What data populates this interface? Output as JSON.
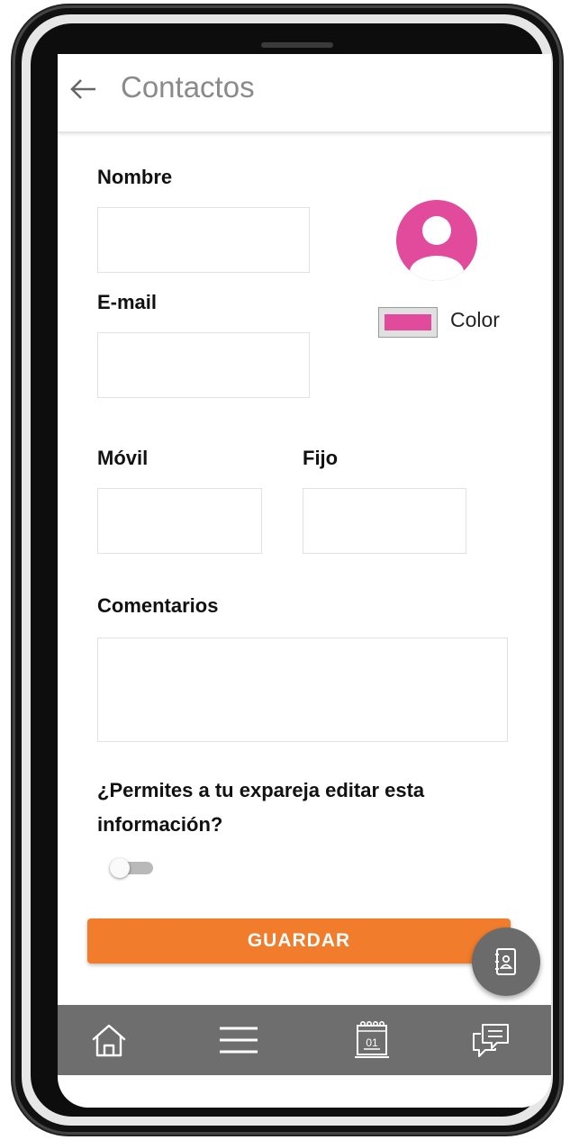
{
  "appbar": {
    "title": "Contactos"
  },
  "form": {
    "nombre_label": "Nombre",
    "email_label": "E-mail",
    "movil_label": "Móvil",
    "fijo_label": "Fijo",
    "comentarios_label": "Comentarios",
    "color_label": "Color",
    "permission_question_line1": "¿Permites a tu expareja editar esta",
    "permission_question_line2": "información?",
    "permission_toggle_on": false
  },
  "actions": {
    "save_label": "GUARDAR"
  },
  "colors": {
    "accent": "#f07c2c",
    "avatar": "#e24a9c",
    "selected_color": "#e24a9c",
    "nav_background": "#6e6e6e"
  },
  "icons": {
    "back": "arrow-left-icon",
    "avatar": "user-avatar-icon",
    "fab": "contacts-book-icon",
    "nav": [
      "home-icon",
      "menu-icon",
      "calendar-icon",
      "chat-icon"
    ]
  }
}
